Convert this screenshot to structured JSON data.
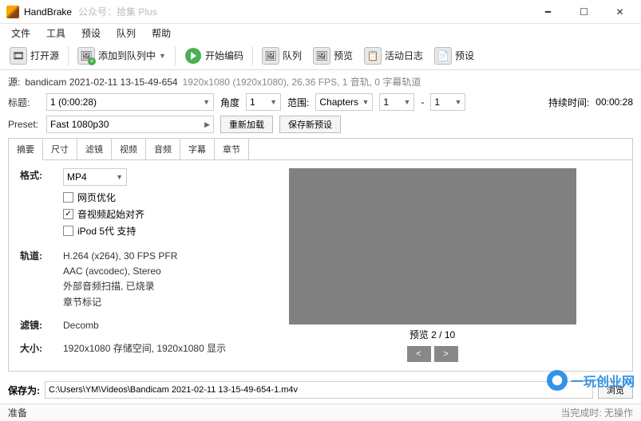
{
  "titlebar": {
    "app_name": "HandBrake",
    "subtitle": "公众号：拾集 Plus"
  },
  "menu": [
    "文件",
    "工具",
    "预设",
    "队列",
    "帮助"
  ],
  "toolbar": {
    "open_source": "打开源",
    "add_queue": "添加到队列中",
    "start_encode": "开始编码",
    "queue": "队列",
    "preview": "预览",
    "activity_log": "活动日志",
    "presets": "预设"
  },
  "source": {
    "label": "源:",
    "name": "bandicam 2021-02-11 13-15-49-654",
    "meta": "1920x1080 (1920x1080), 26.36 FPS, 1 音轨, 0 字幕轨道"
  },
  "title_row": {
    "label": "标题:",
    "title_value": "1 (0:00:28)",
    "angle_label": "角度",
    "angle_value": "1",
    "range_label": "范围:",
    "range_mode": "Chapters",
    "range_start": "1",
    "range_sep": "-",
    "range_end": "1",
    "duration_label": "持续时间:",
    "duration_value": "00:00:28"
  },
  "preset_row": {
    "label": "Preset:",
    "value": "Fast 1080p30",
    "reload": "重新加载",
    "save_new": "保存新预设"
  },
  "tabs": [
    "摘要",
    "尺寸",
    "滤镜",
    "视频",
    "音频",
    "字幕",
    "章节"
  ],
  "summary": {
    "format_label": "格式:",
    "format_value": "MP4",
    "web_opt": "网页优化",
    "av_start": "音视频起始对齐",
    "ipod": "iPod 5代 支持",
    "track_label": "轨道:",
    "track_lines": [
      "H.264 (x264), 30 FPS PFR",
      "AAC (avcodec), Stereo",
      "外部音频扫描, 已烧录",
      "章节标记"
    ],
    "filter_label": "滤镜:",
    "filter_value": "Decomb",
    "size_label": "大小:",
    "size_value": "1920x1080 存储空间, 1920x1080 显示"
  },
  "preview": {
    "caption": "预览 2 / 10"
  },
  "save": {
    "label": "保存为:",
    "path": "C:\\Users\\YM\\Videos\\Bandicam 2021-02-11 13-15-49-654-1.m4v",
    "browse": "浏览"
  },
  "status": {
    "left": "准备",
    "right": "当完成时: 无操作"
  },
  "watermark": "一玩创业网"
}
